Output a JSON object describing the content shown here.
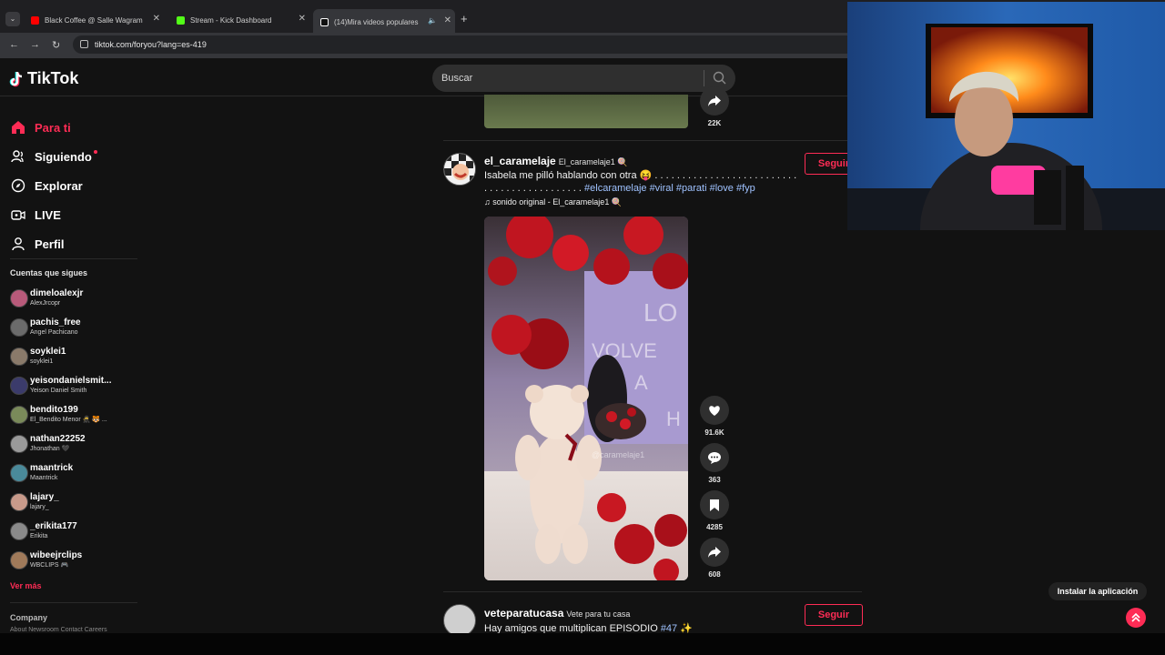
{
  "browser": {
    "tabs": [
      {
        "title": "Black Coffee @ Salle Wagram",
        "color": "#ff0000"
      },
      {
        "title": "Stream - Kick Dashboard",
        "color": "#53fc18"
      },
      {
        "title": "(14)Mira videos populares",
        "color": "#ffffff"
      }
    ],
    "new_tab": "+",
    "url": "tiktok.com/foryou?lang=es-419"
  },
  "tiktok": {
    "logo": "TikTok",
    "search_placeholder": "Buscar",
    "nav": [
      {
        "label": "Para ti",
        "icon": "home-icon"
      },
      {
        "label": "Siguiendo",
        "icon": "following-icon"
      },
      {
        "label": "Explorar",
        "icon": "compass-icon"
      },
      {
        "label": "LIVE",
        "icon": "live-icon"
      },
      {
        "label": "Perfil",
        "icon": "profile-icon"
      }
    ],
    "following_title": "Cuentas que sigues",
    "accounts": [
      {
        "user": "dimeloalexjr",
        "name": "AlexJrcopr"
      },
      {
        "user": "pachis_free",
        "name": "Angel Pachicano"
      },
      {
        "user": "soyklei1",
        "name": "soyklei1"
      },
      {
        "user": "yeisondanielsmit...",
        "name": "Yeison Daniel Smith"
      },
      {
        "user": "bendito199",
        "name": "El_Bendito Menor 🥷 🐯 ..."
      },
      {
        "user": "nathan22252",
        "name": "Jhonathan 🖤"
      },
      {
        "user": "maantrick",
        "name": "Maantrick"
      },
      {
        "user": "lajary_",
        "name": "lajary_"
      },
      {
        "user": "_erikita177",
        "name": "Erikita"
      },
      {
        "user": "wibeejrclips",
        "name": "WBCLIPS 🎮"
      }
    ],
    "see_more": "Ver más",
    "company": "Company",
    "footer_links": "About  Newsroom  Contact  Careers",
    "top_share_count": "22K",
    "post1": {
      "user": "el_caramelaje",
      "nick": "El_caramelaje1 🍭",
      "caption": "Isabela me pilló hablando con otra 😝 . . . . . . . . . . . . . . . . . . . . . . . . . . . . . . . . . . . . . . . . . . . .",
      "hashtags": "#elcaramelaje #viral #parati #love #fyp",
      "sound": "♫ sonido original - El_caramelaje1 🍭",
      "follow": "Seguir",
      "watermark": "@caramelaje1",
      "balloon_text": [
        "LO",
        "VOLVE",
        "A",
        "H"
      ],
      "counts": {
        "likes": "91.6K",
        "comments": "363",
        "saves": "4285",
        "shares": "608"
      }
    },
    "post2": {
      "user": "veteparatucasa",
      "nick": "Vete para tu casa",
      "caption_text": "Hay amigos que multiplican EPISODIO",
      "caption_tag": "#47",
      "caption_emoji": "✨",
      "follow": "Seguir"
    },
    "install_app": "Instalar la aplicación"
  },
  "colors": {
    "accent": "#fe2c55",
    "background": "#121212",
    "hashtag": "#9fc2ff"
  }
}
